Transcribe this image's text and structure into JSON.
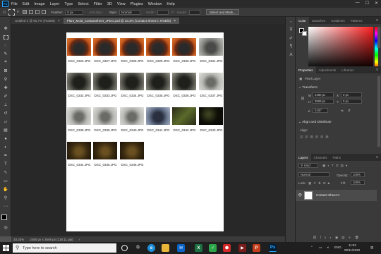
{
  "menubar": {
    "logo": "Ps",
    "items": [
      "File",
      "Edit",
      "Image",
      "Layer",
      "Type",
      "Select",
      "Filter",
      "3D",
      "View",
      "Plugins",
      "Window",
      "Help"
    ],
    "controls": [
      "—",
      "☐",
      "✕"
    ]
  },
  "options": {
    "feather_label": "Feather:",
    "feather_value": "0 px",
    "antialias_label": "Anti-alias",
    "style_label": "Style:",
    "style_value": "Normal",
    "width_label": "Width:",
    "height_label": "Height:",
    "select_mask_label": "Select and Mask..."
  },
  "tabs": [
    {
      "label": "Untitled-1 @ 66.7% (RGB/8)",
      "close": "×"
    },
    {
      "label": "Plant_Mold_ContactSheet_JPEG.psd @ 33.3% (Contact Sheet II, RGB/8)",
      "close": "×"
    }
  ],
  "contact_sheet": {
    "thumbnails": [
      {
        "label": "DSC_0326.JPG",
        "tone": "orange"
      },
      {
        "label": "DSC_0327.JPG",
        "tone": "orange"
      },
      {
        "label": "DSC_0328.JPG",
        "tone": "orange"
      },
      {
        "label": "DSC_0329.JPG",
        "tone": "orange"
      },
      {
        "label": "DSC_0330.JPG",
        "tone": "orange"
      },
      {
        "label": "DSC_0331.JPG",
        "tone": "gray"
      },
      {
        "label": "DSC_0332.JPG",
        "tone": "dark"
      },
      {
        "label": "DSC_0333.JPG",
        "tone": "dark"
      },
      {
        "label": "DSC_0334.JPG",
        "tone": "dark"
      },
      {
        "label": "DSC_0335.JPG",
        "tone": "dark"
      },
      {
        "label": "DSC_0336.JPG",
        "tone": "dark"
      },
      {
        "label": "DSC_0337.JPG",
        "tone": "light"
      },
      {
        "label": "DSC_0338.JPG",
        "tone": "light"
      },
      {
        "label": "DSC_0339.JPG",
        "tone": "light"
      },
      {
        "label": "DSC_0340.JPG",
        "tone": "light"
      },
      {
        "label": "DSC_0341.JPG",
        "tone": "blue"
      },
      {
        "label": "DSC_0342.JPG",
        "tone": "green"
      },
      {
        "label": "DSC_0343.JPG",
        "tone": "black"
      },
      {
        "label": "DSC_0344.JPG",
        "tone": "brown"
      },
      {
        "label": "DSC_0345.JPG",
        "tone": "brown"
      },
      {
        "label": "DSC_0346.JPG",
        "tone": "brown"
      }
    ]
  },
  "status": {
    "zoom": "33.33%",
    "doc": "2480 px x 3508 px (118.11 ppi)"
  },
  "panels": {
    "color_tabs": [
      "Color",
      "Swatches",
      "Gradients",
      "Patterns"
    ],
    "props_tabs": [
      "Properties",
      "Adjustments",
      "Libraries"
    ],
    "pixel_layer": "Pixel Layer",
    "transform_title": "Transform",
    "w_label": "W",
    "w_value": "2480 px",
    "h_label": "H",
    "h_value": "3508 px",
    "x_label": "X",
    "x_value": "0 px",
    "y_label": "Y",
    "y_value": "0 px",
    "angle_value": "0.00°",
    "align_title": "Align and Distribute",
    "align_label": "Align:",
    "layers_tabs": [
      "Layers",
      "Channels",
      "Paths"
    ],
    "kind_label": "Kind",
    "blend_mode": "Normal",
    "opacity_label": "Opacity:",
    "opacity_value": "100%",
    "lock_label": "Lock:",
    "fill_label": "Fill:",
    "fill_value": "100%",
    "layer_name": "Contact Sheet II"
  },
  "taskbar": {
    "search_placeholder": "Type here to search",
    "lang": "ENG",
    "time": "11:52",
    "date": "09/11/2020"
  },
  "colors": {
    "accent": "#31a8ff",
    "menubar_bg": "#2b2b2b",
    "panel_bg": "#3a3a3a",
    "workspace_bg": "#282828"
  }
}
